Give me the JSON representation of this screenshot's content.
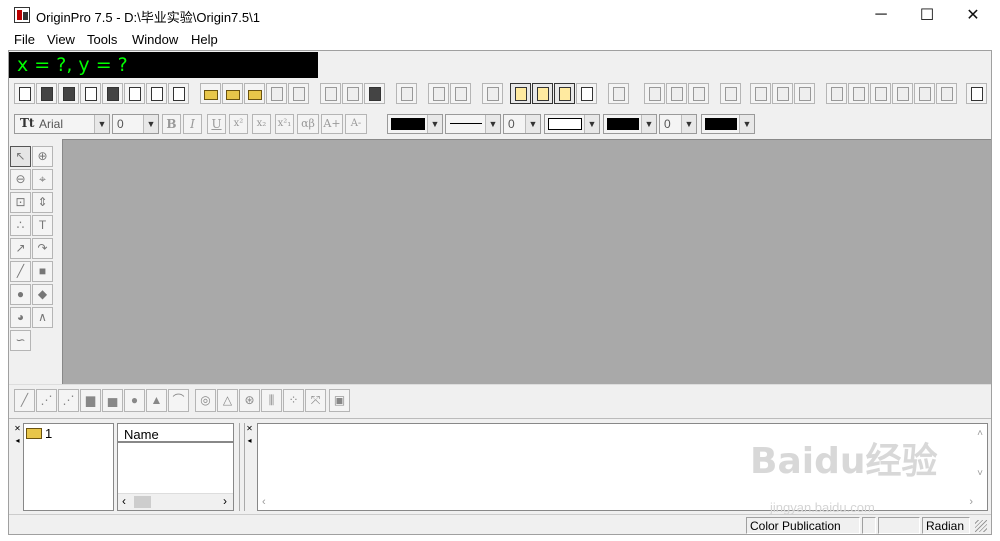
{
  "window": {
    "title": "OriginPro 7.5 - D:\\毕业实验\\Origin7.5\\1",
    "controls": {
      "minimize": "─",
      "maximize": "☐",
      "close": "✕"
    }
  },
  "menu": {
    "items": [
      "File",
      "View",
      "Tools",
      "Window",
      "Help"
    ]
  },
  "coordinate_display": "x = ?, y = ?",
  "format_toolbar": {
    "font_name": "Arial",
    "font_size": "0",
    "line_width_value": "0",
    "symbol_size_value": "0",
    "bold": "B",
    "italic": "I",
    "underline": "U",
    "superscript": "x²",
    "subscript": "x₂",
    "supsub": "x²₁",
    "greek": "αβ",
    "increase_font": "A+",
    "decrease_font": "A-"
  },
  "tools": [
    "pointer-tool",
    "zoom-in-tool",
    "zoom-out-tool",
    "screen-reader-tool",
    "data-selector-tool",
    "data-reader-tool",
    "data-marker-tool",
    "text-tool",
    "arrow-tool",
    "curved-arrow-tool",
    "line-tool",
    "rectangle-tool",
    "circle-tool",
    "polygon-tool",
    "region-tool",
    "polyline-tool",
    "freehand-tool"
  ],
  "explorer": {
    "root_folder": "1",
    "list_header": "Name"
  },
  "status": {
    "mode": "Color Publication",
    "angle_unit": "Radian"
  },
  "watermark": {
    "brand": "Baidu经验",
    "url": "jingyan.baidu.com"
  },
  "colors": {
    "coord_bg": "#000000",
    "coord_text": "#00ff00",
    "workspace": "#a9a9a9"
  }
}
